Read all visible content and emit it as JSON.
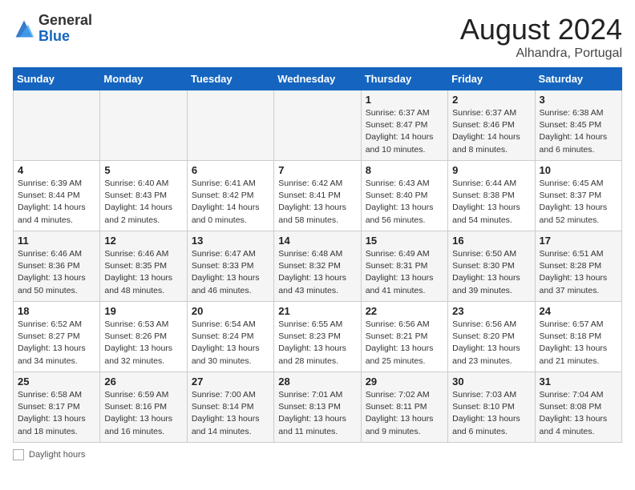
{
  "header": {
    "logo_general": "General",
    "logo_blue": "Blue",
    "month_year": "August 2024",
    "location": "Alhandra, Portugal"
  },
  "days_of_week": [
    "Sunday",
    "Monday",
    "Tuesday",
    "Wednesday",
    "Thursday",
    "Friday",
    "Saturday"
  ],
  "footer": {
    "label": "Daylight hours"
  },
  "weeks": [
    [
      {
        "day": "",
        "info": ""
      },
      {
        "day": "",
        "info": ""
      },
      {
        "day": "",
        "info": ""
      },
      {
        "day": "",
        "info": ""
      },
      {
        "day": "1",
        "info": "Sunrise: 6:37 AM\nSunset: 8:47 PM\nDaylight: 14 hours\nand 10 minutes."
      },
      {
        "day": "2",
        "info": "Sunrise: 6:37 AM\nSunset: 8:46 PM\nDaylight: 14 hours\nand 8 minutes."
      },
      {
        "day": "3",
        "info": "Sunrise: 6:38 AM\nSunset: 8:45 PM\nDaylight: 14 hours\nand 6 minutes."
      }
    ],
    [
      {
        "day": "4",
        "info": "Sunrise: 6:39 AM\nSunset: 8:44 PM\nDaylight: 14 hours\nand 4 minutes."
      },
      {
        "day": "5",
        "info": "Sunrise: 6:40 AM\nSunset: 8:43 PM\nDaylight: 14 hours\nand 2 minutes."
      },
      {
        "day": "6",
        "info": "Sunrise: 6:41 AM\nSunset: 8:42 PM\nDaylight: 14 hours\nand 0 minutes."
      },
      {
        "day": "7",
        "info": "Sunrise: 6:42 AM\nSunset: 8:41 PM\nDaylight: 13 hours\nand 58 minutes."
      },
      {
        "day": "8",
        "info": "Sunrise: 6:43 AM\nSunset: 8:40 PM\nDaylight: 13 hours\nand 56 minutes."
      },
      {
        "day": "9",
        "info": "Sunrise: 6:44 AM\nSunset: 8:38 PM\nDaylight: 13 hours\nand 54 minutes."
      },
      {
        "day": "10",
        "info": "Sunrise: 6:45 AM\nSunset: 8:37 PM\nDaylight: 13 hours\nand 52 minutes."
      }
    ],
    [
      {
        "day": "11",
        "info": "Sunrise: 6:46 AM\nSunset: 8:36 PM\nDaylight: 13 hours\nand 50 minutes."
      },
      {
        "day": "12",
        "info": "Sunrise: 6:46 AM\nSunset: 8:35 PM\nDaylight: 13 hours\nand 48 minutes."
      },
      {
        "day": "13",
        "info": "Sunrise: 6:47 AM\nSunset: 8:33 PM\nDaylight: 13 hours\nand 46 minutes."
      },
      {
        "day": "14",
        "info": "Sunrise: 6:48 AM\nSunset: 8:32 PM\nDaylight: 13 hours\nand 43 minutes."
      },
      {
        "day": "15",
        "info": "Sunrise: 6:49 AM\nSunset: 8:31 PM\nDaylight: 13 hours\nand 41 minutes."
      },
      {
        "day": "16",
        "info": "Sunrise: 6:50 AM\nSunset: 8:30 PM\nDaylight: 13 hours\nand 39 minutes."
      },
      {
        "day": "17",
        "info": "Sunrise: 6:51 AM\nSunset: 8:28 PM\nDaylight: 13 hours\nand 37 minutes."
      }
    ],
    [
      {
        "day": "18",
        "info": "Sunrise: 6:52 AM\nSunset: 8:27 PM\nDaylight: 13 hours\nand 34 minutes."
      },
      {
        "day": "19",
        "info": "Sunrise: 6:53 AM\nSunset: 8:26 PM\nDaylight: 13 hours\nand 32 minutes."
      },
      {
        "day": "20",
        "info": "Sunrise: 6:54 AM\nSunset: 8:24 PM\nDaylight: 13 hours\nand 30 minutes."
      },
      {
        "day": "21",
        "info": "Sunrise: 6:55 AM\nSunset: 8:23 PM\nDaylight: 13 hours\nand 28 minutes."
      },
      {
        "day": "22",
        "info": "Sunrise: 6:56 AM\nSunset: 8:21 PM\nDaylight: 13 hours\nand 25 minutes."
      },
      {
        "day": "23",
        "info": "Sunrise: 6:56 AM\nSunset: 8:20 PM\nDaylight: 13 hours\nand 23 minutes."
      },
      {
        "day": "24",
        "info": "Sunrise: 6:57 AM\nSunset: 8:18 PM\nDaylight: 13 hours\nand 21 minutes."
      }
    ],
    [
      {
        "day": "25",
        "info": "Sunrise: 6:58 AM\nSunset: 8:17 PM\nDaylight: 13 hours\nand 18 minutes."
      },
      {
        "day": "26",
        "info": "Sunrise: 6:59 AM\nSunset: 8:16 PM\nDaylight: 13 hours\nand 16 minutes."
      },
      {
        "day": "27",
        "info": "Sunrise: 7:00 AM\nSunset: 8:14 PM\nDaylight: 13 hours\nand 14 minutes."
      },
      {
        "day": "28",
        "info": "Sunrise: 7:01 AM\nSunset: 8:13 PM\nDaylight: 13 hours\nand 11 minutes."
      },
      {
        "day": "29",
        "info": "Sunrise: 7:02 AM\nSunset: 8:11 PM\nDaylight: 13 hours\nand 9 minutes."
      },
      {
        "day": "30",
        "info": "Sunrise: 7:03 AM\nSunset: 8:10 PM\nDaylight: 13 hours\nand 6 minutes."
      },
      {
        "day": "31",
        "info": "Sunrise: 7:04 AM\nSunset: 8:08 PM\nDaylight: 13 hours\nand 4 minutes."
      }
    ]
  ]
}
